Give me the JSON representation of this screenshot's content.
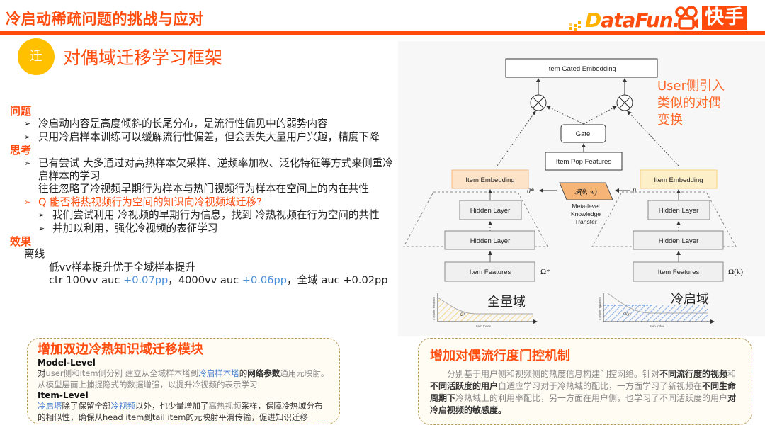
{
  "header": {
    "title": "冷启动稀疏问题的挑战与应对",
    "logo_datafun_d": "D",
    "logo_datafun_rest": "ataFun.",
    "logo_kuaishou": "快手"
  },
  "section": {
    "icon_char": "迁",
    "title": "对偶域迁移学习框架"
  },
  "left": {
    "problem_heading": "问题",
    "problem_items": [
      "冷启动内容是高度倾斜的长尾分布，是流行性偏见中的弱势内容",
      "只用冷启样本训练可以缓解流行性偏差，但会丢失大量用户兴趣，精度下降"
    ],
    "thinking_heading": "思考",
    "thinking_item1_line1": "已有尝试 大多通过对高热样本欠采样、逆频率加权、泛化特征等方式来侧重冷",
    "thinking_item1_line2": "启样本的学习",
    "thinking_item1_line3": "往往忽略了冷视频早期行为样本与热门视频行为样本在空间上的内在共性",
    "question": "Q 能否将热视频行为空间的知识向冷视频域迁移?",
    "sub_items": [
      "我们尝试利用 冷视频的早期行为信息，找到 冷热视频在行为空间的共性",
      "并加以利用，强化冷视频的表征学习"
    ],
    "effect_heading": "效果",
    "offline_label": "离线",
    "offline_summary": "低vv样本提升优于全域样本提升",
    "metrics": {
      "prefix": "ctr 100vv auc ",
      "v1": "+0.07pp",
      "mid": "，4000vv auc ",
      "v2": "+0.06pp",
      "suffix": "，全域 auc +0.02pp"
    }
  },
  "diagram": {
    "top_box": "Item Gated Embedding",
    "gate": "Gate",
    "pop_features": "Item Pop Features",
    "left_embedding": "Item Embedding",
    "right_embedding": "Item Embedding",
    "hidden_layer": "Hidden Layer",
    "item_features": "Item Features",
    "theta_star": "θ*",
    "theta": "θ",
    "transfer_fn": "𝓕(θ; w)",
    "transfer_label_1": "Meta-level",
    "transfer_label_2": "Knowledge",
    "transfer_label_3": "Transfer",
    "omega_star": "Ω*",
    "omega_k": "Ω(k)",
    "left_domain": "全量域",
    "right_domain": "冷启域",
    "axis_y": "# of user feedback",
    "axis_x": "Item Index",
    "k_label": "k",
    "user_note": [
      "User侧引入",
      "类似的对偶",
      "变换"
    ]
  },
  "box_left": {
    "title": "增加双边冷热知识域迁移模块",
    "model_level": "Model-Level",
    "model_text": {
      "a": "对",
      "b": "user侧和item侧分别 建立从全域样本塔到",
      "c": "冷启样本塔",
      "d": "的",
      "e": "网络参数",
      "f": "通用元映射。从模型层面上捕捉隐式的数据增强，以提升冷视频的表示学习"
    },
    "item_level": "Item-Level",
    "item_text": {
      "a": "冷启塔",
      "b": "除了保留全部",
      "c": "冷视频",
      "d": "以外，也少量增加了",
      "e": "高热视频",
      "f": "采样，保障冷热域分布的相似性，确保从head item到tail item的元映射平滑传输，促进知识迁移"
    }
  },
  "box_right": {
    "title": "增加对偶流行度门控机制",
    "text": {
      "a": "分别基于用户侧和视频侧的热度信息构建门控网络。针对",
      "b": "不同流行度的视频",
      "c": "和",
      "d": "不同活跃度的用户",
      "e": "自适应学习对于冷热域的配比，一方面学习了新视频在",
      "f": "不同生命周期下",
      "g": "冷热域上的利用率配比，另一方面在用户侧，也学习了不同活跃度的用户",
      "h": "对冷启视频的敏感度",
      "i": "。"
    }
  },
  "colors": {
    "accent": "#ff4d0f",
    "icon_bg": "#ffc000",
    "highlight_blue": "#4a90d9",
    "embedding_left": "#fde3c8",
    "embedding_right": "#fdf0c8",
    "transfer_fill": "#f7b477",
    "domain_hatch_left": "#f5c96a",
    "domain_hatch_right": "#6d9be0"
  }
}
